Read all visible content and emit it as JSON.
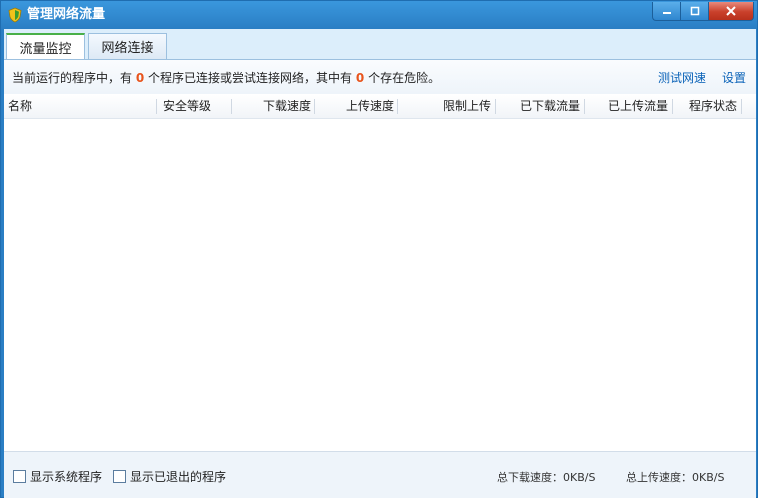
{
  "window": {
    "title": "管理网络流量"
  },
  "tabs": [
    {
      "label": "流量监控"
    },
    {
      "label": "网络连接"
    }
  ],
  "info": {
    "prefix": "当前运行的程序中，有",
    "connected_count": "0",
    "middle": "个程序已连接或尝试连接网络，其中有",
    "danger_count": "0",
    "suffix": "个存在危险。",
    "test_speed_link": "测试网速",
    "settings_link": "设置"
  },
  "table": {
    "columns": [
      "名称",
      "安全等级",
      "下载速度",
      "上传速度",
      "限制上传",
      "已下载流量",
      "已上传流量",
      "程序状态"
    ],
    "rows": []
  },
  "footer": {
    "show_system_label": "显示系统程序",
    "show_exited_label": "显示已退出的程序",
    "total_download": "总下载速度：0KB/S",
    "total_upload": "总上传速度：0KB/S"
  },
  "colors": {
    "accent": "#2a7ec4",
    "highlight": "#e8541c",
    "link": "#0b63b8"
  }
}
